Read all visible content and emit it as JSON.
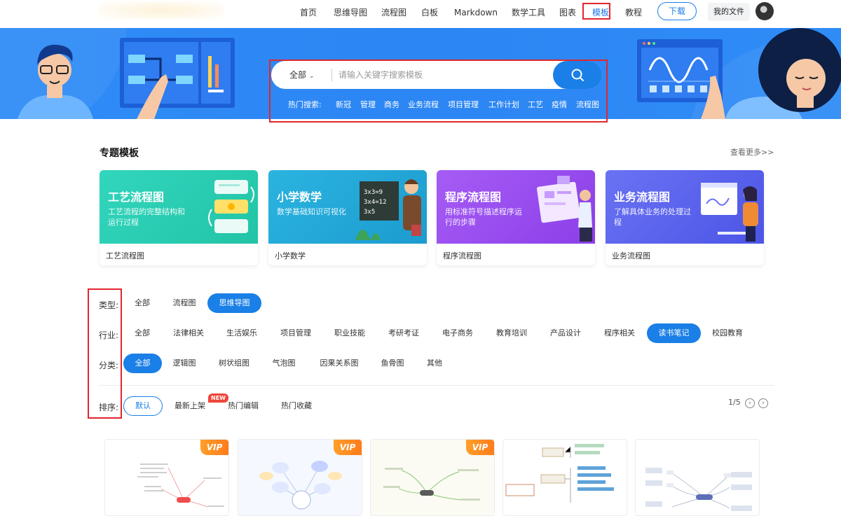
{
  "nav": {
    "items": [
      {
        "label": "首页",
        "name": "nav-home"
      },
      {
        "label": "思维导图",
        "name": "nav-mindmap"
      },
      {
        "label": "流程图",
        "name": "nav-flowchart"
      },
      {
        "label": "白板",
        "name": "nav-whiteboard"
      },
      {
        "label": "Markdown",
        "name": "nav-markdown"
      },
      {
        "label": "数学工具",
        "name": "nav-math-tools"
      },
      {
        "label": "图表",
        "name": "nav-charts"
      },
      {
        "label": "模板",
        "name": "nav-templates",
        "active": true
      },
      {
        "label": "教程",
        "name": "nav-tutorial"
      }
    ],
    "download": "下载",
    "my_files": "我的文件"
  },
  "search": {
    "scope": "全部",
    "placeholder": "请输入关键字搜索模板",
    "hot_label": "热门搜索:",
    "hot_tags": [
      "新冠",
      "管理",
      "商务",
      "业务流程",
      "项目管理",
      "工作计划",
      "工艺",
      "疫情",
      "流程图"
    ]
  },
  "featured": {
    "title": "专题模板",
    "see_more": "查看更多>>",
    "cards": [
      {
        "title": "工艺流程图",
        "desc": "工艺流程的完整结构和运行过程",
        "name": "工艺流程图",
        "color": "#2dcfb3"
      },
      {
        "title": "小学数学",
        "desc": "数学基础知识可视化",
        "name": "小学数学",
        "color": "#23a6d8"
      },
      {
        "title": "程序流程图",
        "desc": "用标准符号描述程序运行的步骤",
        "name": "程序流程图",
        "color": "#9a4ff0"
      },
      {
        "title": "业务流程图",
        "desc": "了解具体业务的处理过程",
        "name": "业务流程图",
        "color": "#5b63ec"
      }
    ]
  },
  "filters": {
    "type": {
      "label": "类型:",
      "options": [
        "全部",
        "流程图",
        "思维导图"
      ],
      "selected": "思维导图"
    },
    "industry": {
      "label": "行业:",
      "options": [
        "全部",
        "法律相关",
        "生活娱乐",
        "项目管理",
        "职业技能",
        "考研考证",
        "电子商务",
        "教育培训",
        "产品设计",
        "程序相关",
        "读书笔记",
        "校园教育"
      ],
      "selected": "读书笔记"
    },
    "category": {
      "label": "分类:",
      "options": [
        "全部",
        "逻辑图",
        "树状组图",
        "气泡图",
        "因果关系图",
        "鱼骨图",
        "其他"
      ],
      "selected": "全部"
    },
    "sort": {
      "label": "排序:",
      "options": [
        "默认",
        "最新上架",
        "热门编辑",
        "热门收藏"
      ],
      "selected": "默认",
      "new_badge": "NEW"
    }
  },
  "pager": {
    "text": "1/5"
  },
  "thumbnails": {
    "vip_label": "VIP"
  },
  "colors": {
    "primary": "#1a7fe6",
    "highlight": "#e0262d",
    "hero": "#2c86f4",
    "vip": "#ff8c1a"
  }
}
